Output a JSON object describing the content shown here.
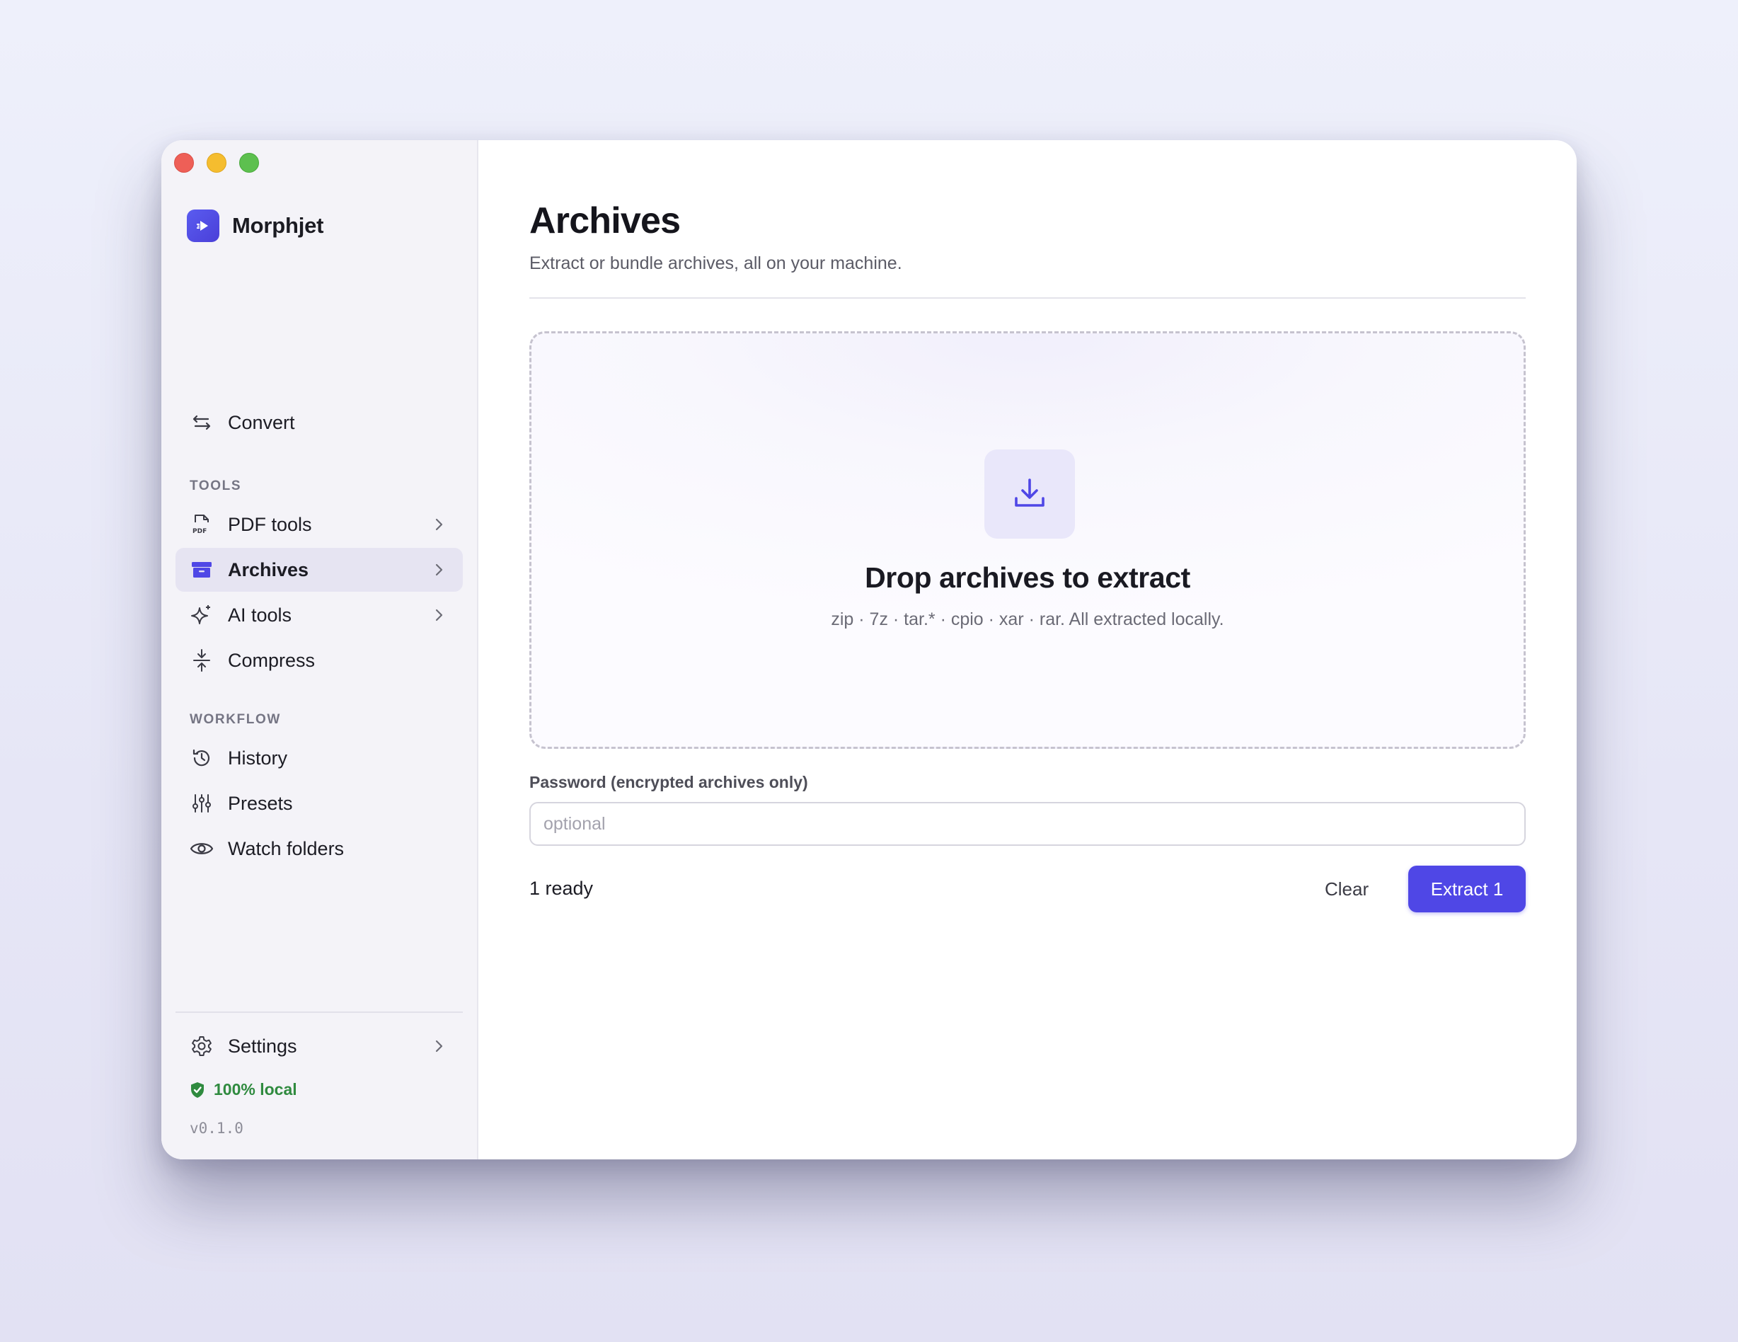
{
  "app": {
    "name": "Morphjet"
  },
  "sidebar": {
    "convert_label": "Convert",
    "tools_heading": "TOOLS",
    "tools": [
      {
        "label": "PDF tools",
        "icon": "pdf-icon"
      },
      {
        "label": "Archives",
        "icon": "archive-icon",
        "active": true
      },
      {
        "label": "AI tools",
        "icon": "sparkle-icon"
      },
      {
        "label": "Compress",
        "icon": "compress-icon"
      }
    ],
    "workflow_heading": "WORKFLOW",
    "workflow": [
      {
        "label": "History",
        "icon": "history-icon"
      },
      {
        "label": "Presets",
        "icon": "sliders-icon"
      },
      {
        "label": "Watch folders",
        "icon": "eye-icon"
      }
    ],
    "settings_label": "Settings",
    "local_badge": "100% local",
    "version": "v0.1.0"
  },
  "main": {
    "title": "Archives",
    "subtitle": "Extract or bundle archives, all on your machine.",
    "dropzone": {
      "title": "Drop archives to extract",
      "formats": "zip · 7z · tar.* · cpio · xar · rar. All extracted locally."
    },
    "password": {
      "label": "Password (encrypted archives only)",
      "placeholder": "optional",
      "value": ""
    },
    "status": "1 ready",
    "clear_label": "Clear",
    "extract_label": "Extract 1"
  },
  "colors": {
    "accent": "#4f47e6",
    "success": "#2f8a3f",
    "sidebar_bg": "#f4f3f8"
  }
}
